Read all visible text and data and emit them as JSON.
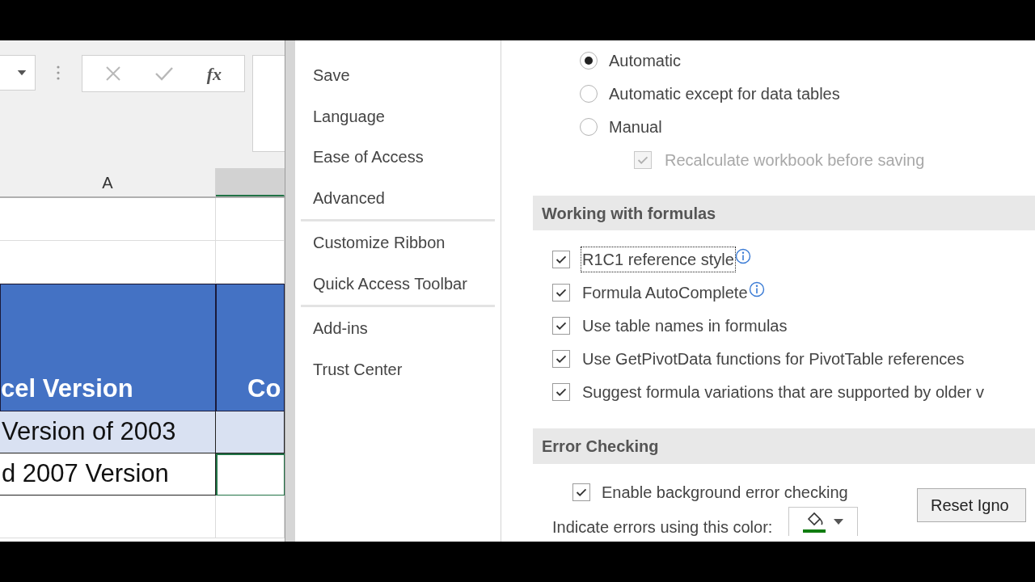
{
  "sheet": {
    "formula_bar": {
      "function_label": "fx"
    },
    "columns": [
      {
        "label": "A",
        "selected": false
      },
      {
        "selected": true
      }
    ],
    "rows": [
      {
        "kind": "blank"
      },
      {
        "kind": "blank"
      },
      {
        "kind": "header",
        "cells": [
          {
            "text": "cel Version",
            "active": false
          },
          {
            "text": "Co",
            "active": false
          }
        ]
      },
      {
        "kind": "banded",
        "cells": [
          {
            "text": "Version of 2003",
            "active": false
          },
          {
            "active": false
          }
        ]
      },
      {
        "kind": "plain",
        "cells": [
          {
            "text": "d 2007 Version",
            "active": false
          },
          {
            "active": true
          }
        ]
      },
      {
        "kind": "blank"
      }
    ]
  },
  "options_sidebar": {
    "groups": [
      [
        "Save",
        "Language",
        "Ease of Access",
        "Advanced"
      ],
      [
        "Customize Ribbon",
        "Quick Access Toolbar"
      ],
      [
        "Add-ins",
        "Trust Center"
      ]
    ]
  },
  "calculation": {
    "radios": [
      {
        "label": "Automatic",
        "selected": true
      },
      {
        "label": "Automatic except for data tables",
        "selected": false
      },
      {
        "label": "Manual",
        "selected": false
      }
    ],
    "sub_option": {
      "label": "Recalculate workbook before saving",
      "checked": true,
      "disabled": true
    }
  },
  "formulas": {
    "title": "Working with formulas",
    "options": [
      {
        "label": "R1C1 reference style",
        "checked": true,
        "focused": true,
        "info": true
      },
      {
        "label": "Formula AutoComplete",
        "checked": true,
        "focused": false,
        "info": true
      },
      {
        "label": "Use table names in formulas",
        "checked": true,
        "focused": false,
        "info": false
      },
      {
        "label": "Use GetPivotData functions for PivotTable references",
        "checked": true,
        "focused": false,
        "info": false
      },
      {
        "label": "Suggest formula variations that are supported by older v",
        "checked": true,
        "focused": false,
        "info": false
      }
    ]
  },
  "error_checking": {
    "title": "Error Checking",
    "enable": {
      "label": "Enable background error checking",
      "checked": true
    },
    "color_label": "Indicate errors using this color:",
    "color": "#107c10",
    "reset_button": "Reset Igno"
  }
}
